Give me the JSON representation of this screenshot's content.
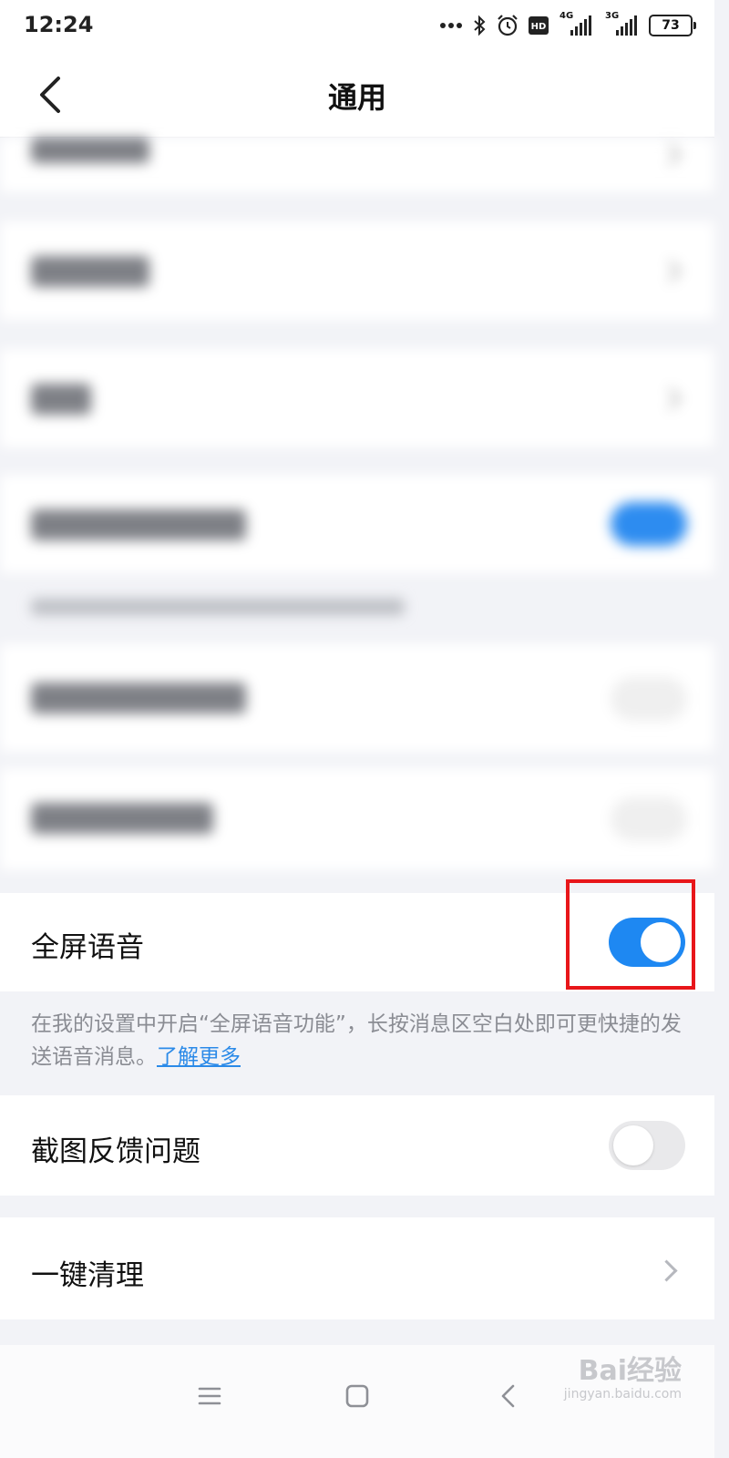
{
  "status_bar": {
    "time": "12:24",
    "network_1": "4G",
    "network_2": "3G",
    "battery": "73",
    "icons": [
      "more-dots-icon",
      "bluetooth-icon",
      "alarm-icon",
      "hd-icon",
      "signal-4g-icon",
      "signal-3g-icon",
      "battery-icon"
    ]
  },
  "header": {
    "title": "通用",
    "back_icon": "chevron-left-icon"
  },
  "settings": {
    "full_screen_voice": {
      "label": "全屏语音",
      "enabled": true
    },
    "description": {
      "text": "在我的设置中开启“全屏语音功能”，长按消息区空白处即可更快捷的发送语音消息。",
      "link": "了解更多"
    },
    "screenshot_feedback": {
      "label": "截图反馈问题",
      "enabled": false
    },
    "one_click_cleanup": {
      "label": "一键清理"
    }
  },
  "bottom_nav": {
    "icons": [
      "menu-icon",
      "home-square-icon",
      "back-chevron-icon"
    ]
  },
  "watermark": {
    "main": "Bai经验",
    "sub": "jingyan.baidu.com"
  },
  "colors": {
    "accent": "#1e88f2",
    "highlight": "#e8161a",
    "link": "#2b8ae8",
    "background": "#f2f3f7"
  }
}
